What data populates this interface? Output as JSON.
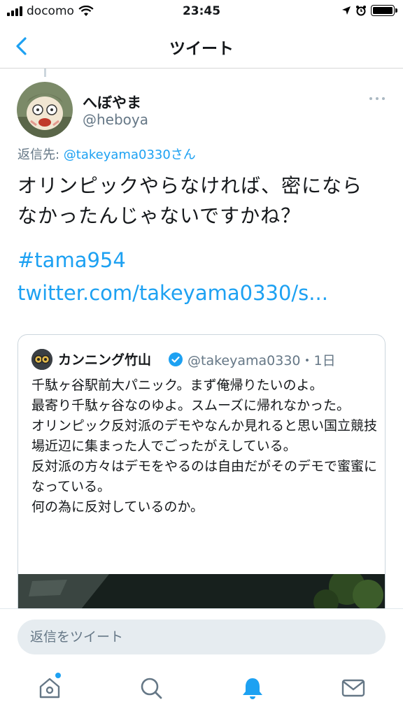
{
  "status_bar": {
    "carrier": "docomo",
    "time": "23:45"
  },
  "nav": {
    "title": "ツイート",
    "back_icon": "chevron-left-icon"
  },
  "tweet": {
    "display_name": "へぼやま",
    "handle": "@heboya",
    "replying_prefix": "返信先: ",
    "replying_to": "@takeyama0330さん",
    "text": "オリンピックやらなければ、密にならなかったんじゃないですかね？",
    "hashtag": "#tama954",
    "link": "twitter.com/takeyama0330/s..."
  },
  "quoted_tweet": {
    "display_name": "カンニング竹山",
    "verified": true,
    "handle_time": "@takeyama0330・1日",
    "text": "千駄ヶ谷駅前大パニック。まず俺帰りたいのよ。\n最寄り千駄ヶ谷なのゆよ。スムーズに帰れなかった。\nオリンピック反対派のデモやなんか見れると思い国立競技場近辺に集まった人でごったがえしている。\n反対派の方々はデモをやるのは自由だがそのデモで蜜蜜になっている。\n何の為に反対しているのか。"
  },
  "reply": {
    "placeholder": "返信をツイート"
  },
  "tabs": [
    {
      "name": "home",
      "icon": "home-icon",
      "notification_dot": true
    },
    {
      "name": "search",
      "icon": "search-icon"
    },
    {
      "name": "notifications",
      "icon": "bell-icon",
      "active": true
    },
    {
      "name": "messages",
      "icon": "mail-icon"
    }
  ],
  "colors": {
    "accent": "#1da1f2",
    "secondary_text": "#657786"
  }
}
